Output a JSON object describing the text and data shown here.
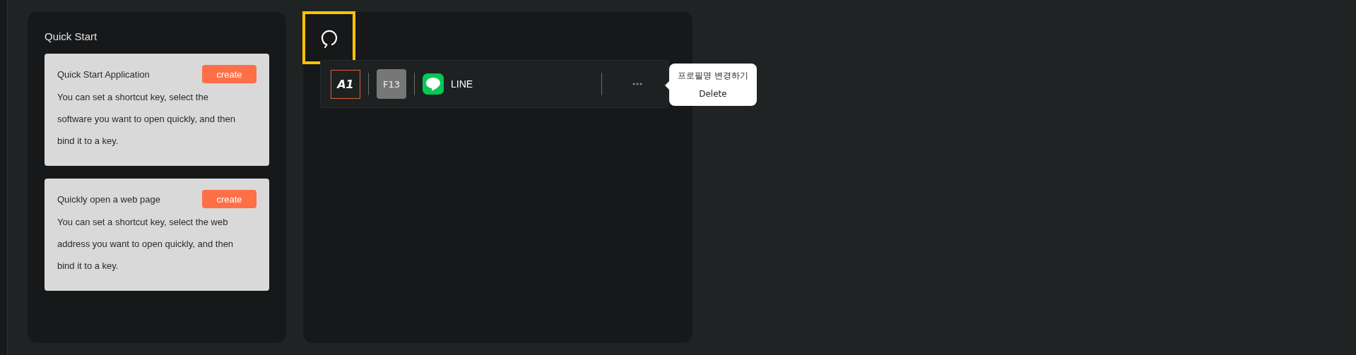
{
  "quick_start": {
    "title": "Quick Start",
    "cards": [
      {
        "title": "Quick Start Application",
        "button": "create",
        "description": "You can set a shortcut key, select the software you want to open quickly, and then bind it to a key."
      },
      {
        "title": "Quickly open a web page",
        "button": "create",
        "description": "You can set a shortcut key, select the web address you want to open quickly, and then bind it to a key."
      }
    ]
  },
  "refresh_button": {
    "highlighted": true
  },
  "shortcuts": [
    {
      "profile": "A1",
      "key": "F13",
      "app": "LINE"
    }
  ],
  "context_menu": {
    "items": [
      "프로필명 변경하기",
      "Delete"
    ]
  }
}
